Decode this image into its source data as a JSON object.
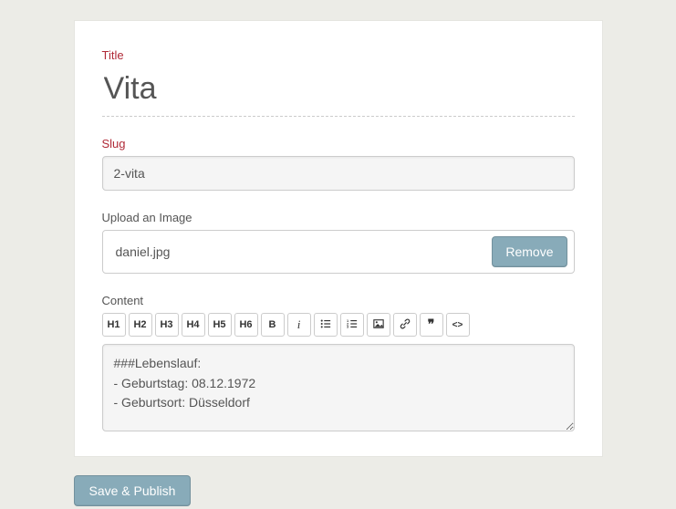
{
  "labels": {
    "title": "Title",
    "slug": "Slug",
    "upload": "Upload an Image",
    "content": "Content"
  },
  "fields": {
    "title": "Vita",
    "slug": "2-vita",
    "upload_name": "daniel.jpg",
    "content": "###Lebenslauf:\n- Geburtstag: 08.12.1972\n- Geburtsort: Düsseldorf"
  },
  "buttons": {
    "remove": "Remove",
    "save_publish": "Save & Publish"
  },
  "toolbar": {
    "h1": "H1",
    "h2": "H2",
    "h3": "H3",
    "h4": "H4",
    "h5": "H5",
    "h6": "H6",
    "bold": "B",
    "italic": "i",
    "quote": "❞",
    "code": "<>"
  }
}
